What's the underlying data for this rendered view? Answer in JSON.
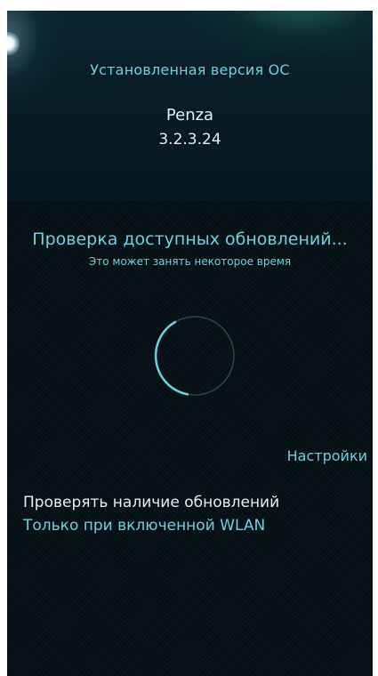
{
  "installed_os": {
    "label": "Установленная версия ОС",
    "name": "Penza",
    "version": "3.2.3.24"
  },
  "update_check": {
    "title": "Проверка доступных обновлений...",
    "subtitle": "Это может занять некоторое время",
    "spinner_icon": "busy-spinner-icon"
  },
  "settings": {
    "header": "Настройки",
    "check_updates": {
      "label": "Проверять наличие обновлений",
      "value": "Только при включенной WLAN"
    }
  },
  "colors": {
    "accent": "#6fd0de",
    "primary_text": "#e6eef0",
    "background": "#041015"
  }
}
